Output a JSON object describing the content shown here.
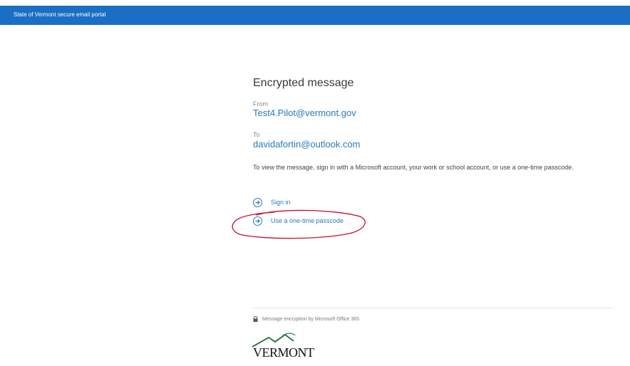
{
  "header": {
    "title": "State of Vermont secure email portal",
    "color": "#1a6fc4"
  },
  "main": {
    "title": "Encrypted message",
    "from_label": "From",
    "from_value": "Test4.Pilot@vermont.gov",
    "to_label": "To",
    "to_value": "davidafortin@outlook.com",
    "instructions": "To view the message, sign in with a Microsoft account, your work or school account, or use a one-time passcode.",
    "actions": [
      {
        "label": "Sign in",
        "icon": "arrow-right-circle-icon"
      },
      {
        "label": "Use a one-time passcode",
        "icon": "arrow-right-circle-icon"
      }
    ],
    "accent_color": "#2a7ab9",
    "annotation_color": "#c8102e"
  },
  "footer": {
    "encryption_note": "Message encryption by Microsoft Office 365",
    "lock_icon": "lock-icon",
    "logo_text": "VERMONT"
  }
}
